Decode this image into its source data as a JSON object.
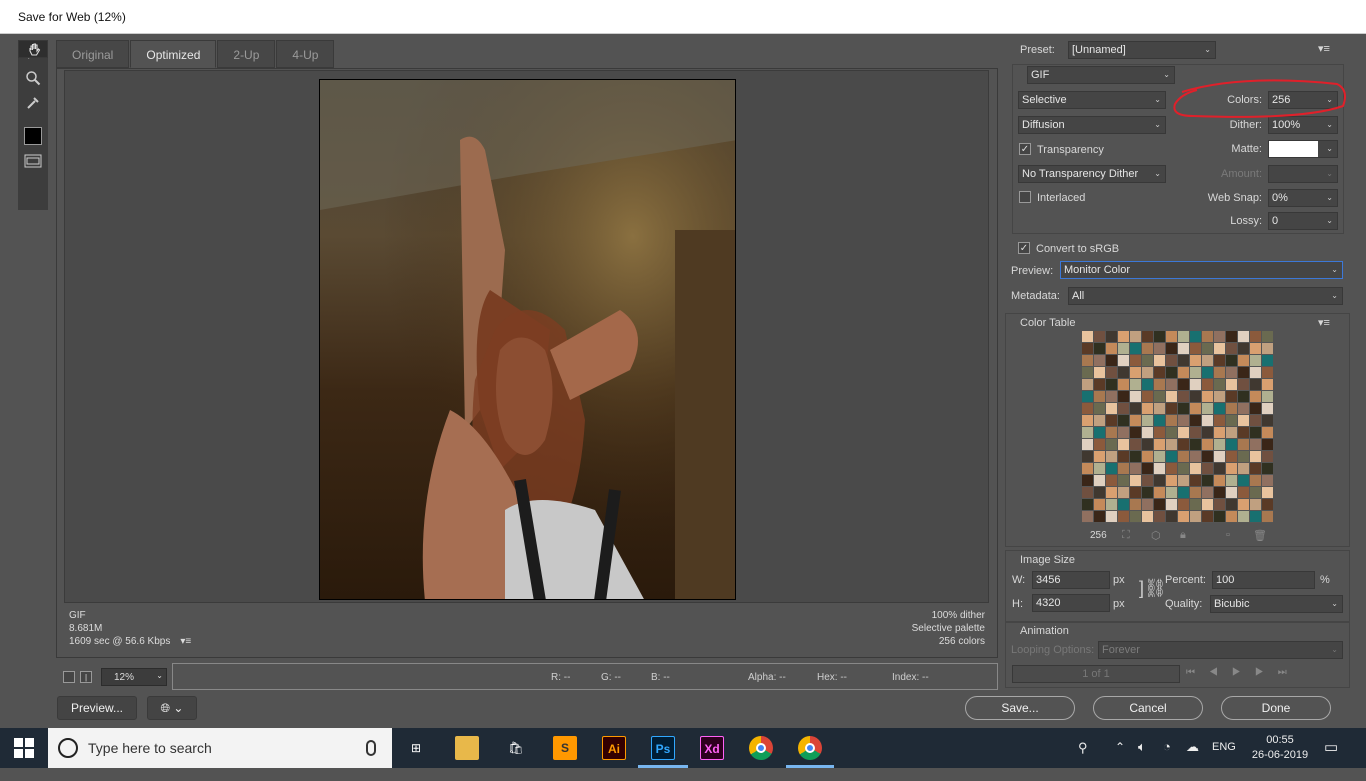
{
  "window": {
    "title": "Save for Web (12%)"
  },
  "tabs": [
    "Original",
    "Optimized",
    "2-Up",
    "4-Up"
  ],
  "image_info": {
    "left": [
      "GIF",
      "8.681M",
      "1609 sec @ 56.6 Kbps"
    ],
    "right": [
      "100% dither",
      "Selective palette",
      "256 colors"
    ]
  },
  "status": {
    "zoom": "12%",
    "r": "R: --",
    "g": "G: --",
    "b": "B: --",
    "alpha": "Alpha: --",
    "hex": "Hex: --",
    "index": "Index: --"
  },
  "buttons": {
    "preview": "Preview...",
    "save": "Save...",
    "cancel": "Cancel",
    "done": "Done"
  },
  "settings": {
    "preset_label": "Preset:",
    "preset": "[Unnamed]",
    "format": "GIF",
    "reduction": "Selective",
    "dither_algo": "Diffusion",
    "colors_label": "Colors:",
    "colors": "256",
    "dither_label": "Dither:",
    "dither": "100%",
    "transparency": "Transparency",
    "matte_label": "Matte:",
    "trans_dither": "No Transparency Dither",
    "amount_label": "Amount:",
    "interlaced": "Interlaced",
    "websnap_label": "Web Snap:",
    "websnap": "0%",
    "lossy_label": "Lossy:",
    "lossy": "0",
    "convert": "Convert to sRGB",
    "preview_label": "Preview:",
    "preview_val": "Monitor Color",
    "metadata_label": "Metadata:",
    "metadata": "All"
  },
  "color_table": {
    "title": "Color Table",
    "count": "256"
  },
  "image_size": {
    "title": "Image Size",
    "w_label": "W:",
    "w": "3456",
    "h_label": "H:",
    "h": "4320",
    "px": "px",
    "percent_label": "Percent:",
    "percent": "100",
    "pct": "%",
    "quality_label": "Quality:",
    "quality": "Bicubic"
  },
  "animation": {
    "title": "Animation",
    "looping_label": "Looping Options:",
    "looping": "Forever",
    "frame": "1 of 1"
  },
  "taskbar": {
    "search": "Type here to search",
    "lang": "ENG",
    "time": "00:55",
    "date": "26-06-2019"
  },
  "colors": {
    "annotation": "#e0202a",
    "accent": "#3c78d8"
  }
}
